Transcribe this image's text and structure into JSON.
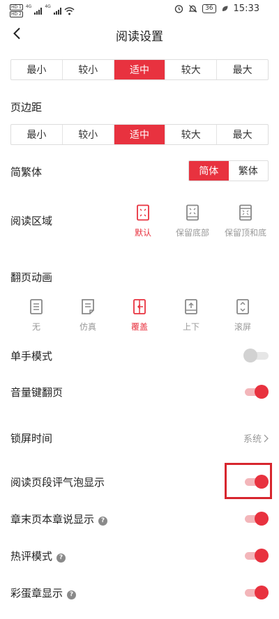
{
  "status_bar": {
    "left_badges": [
      "HD 1",
      "HD 2"
    ],
    "network": [
      "4G",
      "4G"
    ],
    "battery": "36",
    "time": "15:33",
    "icons": [
      "alarm-icon",
      "mute-icon",
      "battery-icon",
      "leaf-icon"
    ]
  },
  "header": {
    "title": "阅读设置",
    "back_icon": "chevron-left-icon"
  },
  "font_size": {
    "options": [
      "最小",
      "较小",
      "适中",
      "较大",
      "最大"
    ],
    "selected": "适中"
  },
  "margin": {
    "label": "页边距",
    "options": [
      "最小",
      "较小",
      "适中",
      "较大",
      "最大"
    ],
    "selected": "适中"
  },
  "script": {
    "label": "简繁体",
    "options": [
      "简体",
      "繁体"
    ],
    "selected": "简体"
  },
  "reading_area": {
    "label": "阅读区域",
    "options": [
      {
        "label": "默认",
        "icon": "area-default-icon"
      },
      {
        "label": "保留底部",
        "icon": "area-keep-bottom-icon"
      },
      {
        "label": "保留顶和底",
        "icon": "area-keep-top-bottom-icon"
      }
    ],
    "selected": "默认"
  },
  "page_flip": {
    "label": "翻页动画",
    "options": [
      {
        "label": "无",
        "icon": "flip-none-icon"
      },
      {
        "label": "仿真",
        "icon": "flip-simulate-icon"
      },
      {
        "label": "覆盖",
        "icon": "flip-cover-icon"
      },
      {
        "label": "上下",
        "icon": "flip-vertical-icon"
      },
      {
        "label": "滚屏",
        "icon": "flip-scroll-icon"
      }
    ],
    "selected": "覆盖"
  },
  "settings": {
    "one_hand": {
      "label": "单手模式",
      "on": false
    },
    "volume_flip": {
      "label": "音量键翻页",
      "on": true
    },
    "lock_time": {
      "label": "锁屏时间",
      "value": "系统"
    },
    "paragraph_bubble": {
      "label": "阅读页段评气泡显示",
      "on": true
    },
    "chapter_end": {
      "label": "章末页本章说显示",
      "on": true,
      "help": "?"
    },
    "hot_comments": {
      "label": "热评模式",
      "on": true,
      "help": "?"
    },
    "easter_egg": {
      "label": "彩蛋章显示",
      "on": true,
      "help": "?"
    }
  },
  "colors": {
    "accent": "#e8323f",
    "accent_light": "#f3b6ba",
    "highlight_border": "#d7262e"
  }
}
